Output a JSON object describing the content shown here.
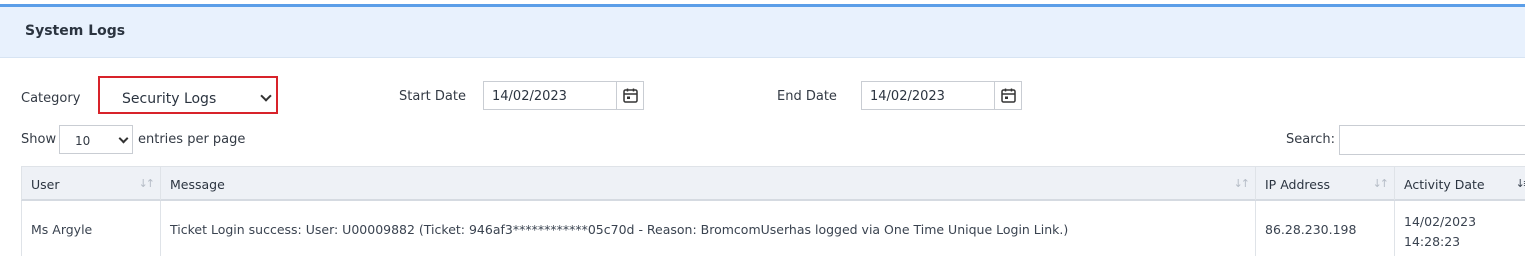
{
  "panel": {
    "title": "System Logs"
  },
  "filters": {
    "category_label": "Category",
    "category_value": "Security Logs",
    "start_label": "Start Date",
    "start_value": "14/02/2023",
    "end_label": "End Date",
    "end_value": "14/02/2023"
  },
  "table_controls": {
    "show_label": "Show",
    "entries_value": "10",
    "entries_suffix": "entries per page",
    "search_label": "Search:",
    "search_value": ""
  },
  "table": {
    "columns": [
      "User",
      "Message",
      "IP Address",
      "Activity Date"
    ],
    "rows": [
      {
        "user": "Ms Argyle",
        "message": "Ticket Login success: User: U00009882 (Ticket: 946af3************05c70d - Reason: BromcomUserhas logged via One Time Unique Login Link.)",
        "ip": "86.28.230.198",
        "date": "14/02/2023",
        "time": "14:28:23"
      }
    ]
  },
  "icons": {
    "calendar": "calendar-icon",
    "chevron": "chevron-down-icon",
    "sort": "sort-icon"
  },
  "colors": {
    "accent_bar": "#5b9ee8",
    "header_bg": "#e8f1fd",
    "highlight_border": "#d8232a"
  }
}
